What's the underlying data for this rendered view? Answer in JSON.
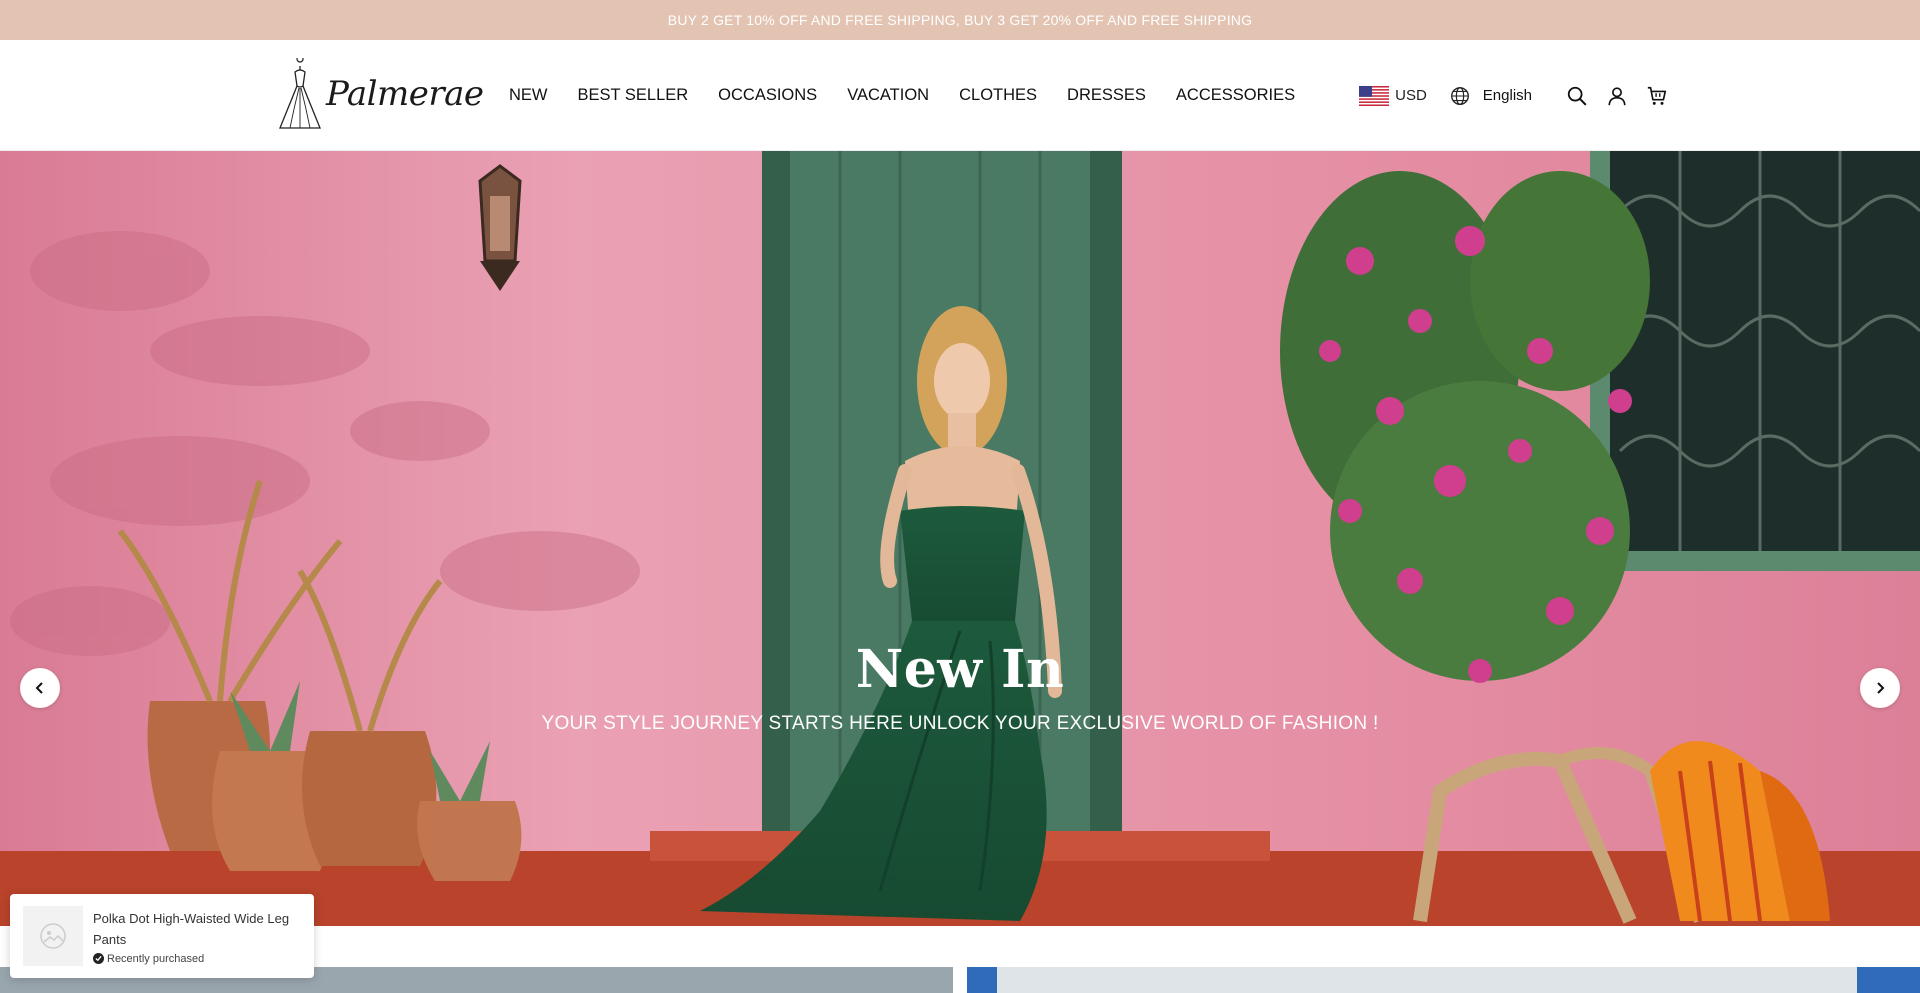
{
  "announcement": {
    "text": "BUY 2 GET 10% OFF AND FREE SHIPPING, BUY 3 GET 20% OFF AND FREE SHIPPING"
  },
  "header": {
    "logo_text": "Palmerae",
    "nav": [
      {
        "label": "NEW"
      },
      {
        "label": "BEST SELLER"
      },
      {
        "label": "OCCASIONS"
      },
      {
        "label": "VACATION"
      },
      {
        "label": "CLOTHES"
      },
      {
        "label": "DRESSES"
      },
      {
        "label": "ACCESSORIES"
      }
    ],
    "currency": "USD",
    "language": "English",
    "icons": [
      "us-flag-icon",
      "globe-icon",
      "search-icon",
      "account-icon",
      "cart-icon"
    ]
  },
  "hero": {
    "title": "New In",
    "subtitle": "YOUR STYLE JOURNEY STARTS HERE UNLOCK YOUR EXCLUSIVE WORLD OF FASHION !",
    "prev_icon": "chevron-left-icon",
    "next_icon": "chevron-right-icon"
  },
  "popup": {
    "product_name": "Polka Dot High-Waisted Wide Leg Pants",
    "status": "Recently purchased",
    "status_icon": "check-circle-icon"
  },
  "colors": {
    "announcement_bg": "#e3c4b2",
    "wall_pink": "#e48fa2",
    "dress_green": "#1f5f3f",
    "door_green": "#3f6b55",
    "floor_red": "#c04a2f",
    "blanket_orange": "#f08a1c"
  }
}
